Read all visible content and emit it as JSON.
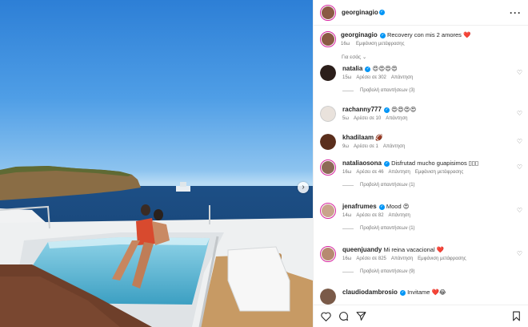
{
  "post": {
    "username": "georginagio",
    "media": {
      "carousel_next": "›"
    }
  },
  "caption": {
    "username": "georginagio",
    "text": "Recovery con mis 2 amores ❤️",
    "time": "16ω",
    "translate": "Εμφάνιση μετάφρασης"
  },
  "for_you_label": "Για εσάς ⌄",
  "comments": [
    {
      "username": "natalia",
      "verified": true,
      "text": "😍😍😍😍",
      "time": "15ω",
      "likes": "Αρέσει σε 302",
      "reply": "Απάντηση",
      "translate": "",
      "view_replies": "Προβολή απαντήσεων (3)"
    },
    {
      "username": "rachanny777",
      "verified": true,
      "text": "😍😍😍😍",
      "time": "5ω",
      "likes": "Αρέσει σε 10",
      "reply": "Απάντηση",
      "translate": "",
      "view_replies": ""
    },
    {
      "username": "khadilaam",
      "verified": false,
      "text": "🏈",
      "time": "9ω",
      "likes": "Αρέσει σε 1",
      "reply": "Απάντηση",
      "translate": "",
      "view_replies": ""
    },
    {
      "username": "nataliaosona",
      "verified": true,
      "text": "Disfrutad mucho guapisimos ▯▯▯",
      "time": "16ω",
      "likes": "Αρέσει σε 46",
      "reply": "Απάντηση",
      "translate": "Εμφάνιση μετάφρασης",
      "view_replies": "Προβολή απαντήσεων (1)"
    },
    {
      "username": "jenafrumes",
      "verified": true,
      "text": "Mood 😍",
      "time": "14ω",
      "likes": "Αρέσει σε 82",
      "reply": "Απάντηση",
      "translate": "",
      "view_replies": "Προβολή απαντήσεων (1)"
    },
    {
      "username": "queenjuandy",
      "verified": false,
      "text": "Mi reina vacacional ❤️",
      "time": "16ω",
      "likes": "Αρέσει σε 825",
      "reply": "Απάντηση",
      "translate": "Εμφάνιση μετάφρασης",
      "view_replies": "Προβολή απαντήσεων (9)"
    },
    {
      "username": "claudiodambrosio",
      "verified": true,
      "text": "Invitame ❤️😂",
      "time": "",
      "likes": "",
      "reply": "",
      "translate": "",
      "view_replies": ""
    }
  ],
  "icons": {
    "heart": "heart-icon",
    "comment": "comment-icon",
    "share": "share-icon",
    "bookmark": "bookmark-icon",
    "more": "more-options-icon",
    "verified": "verified-badge-icon"
  },
  "colors": {
    "verified": "#0095f6",
    "ring": "#d6249f",
    "muted": "#737373"
  }
}
